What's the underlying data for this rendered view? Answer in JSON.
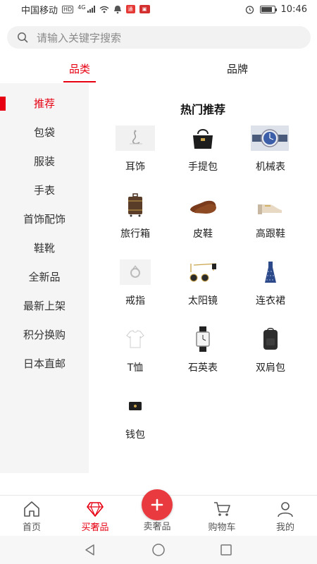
{
  "status_bar": {
    "carrier": "中国移动",
    "hd_badge": "HD",
    "network": "4G",
    "time": "10:46",
    "battery_level": 0.85
  },
  "search": {
    "placeholder": "请输入关键字搜索",
    "icon": "search-icon"
  },
  "tabs": [
    {
      "label": "品类",
      "active": true
    },
    {
      "label": "品牌",
      "active": false
    }
  ],
  "sidebar": {
    "items": [
      {
        "label": "推荐",
        "active": true
      },
      {
        "label": "包袋"
      },
      {
        "label": "服装"
      },
      {
        "label": "手表"
      },
      {
        "label": "首饰配饰"
      },
      {
        "label": "鞋靴"
      },
      {
        "label": "全新品"
      },
      {
        "label": "最新上架"
      },
      {
        "label": "积分换购"
      },
      {
        "label": "日本直邮"
      }
    ]
  },
  "main": {
    "section_title": "热门推荐",
    "items": [
      {
        "label": "耳饰",
        "icon": "earring-icon"
      },
      {
        "label": "手提包",
        "icon": "handbag-icon"
      },
      {
        "label": "机械表",
        "icon": "watch-icon"
      },
      {
        "label": "旅行箱",
        "icon": "suitcase-icon"
      },
      {
        "label": "皮鞋",
        "icon": "loafer-icon"
      },
      {
        "label": "高跟鞋",
        "icon": "heels-icon"
      },
      {
        "label": "戒指",
        "icon": "ring-icon"
      },
      {
        "label": "太阳镜",
        "icon": "sunglasses-icon"
      },
      {
        "label": "连衣裙",
        "icon": "dress-icon"
      },
      {
        "label": "T恤",
        "icon": "tshirt-icon"
      },
      {
        "label": "石英表",
        "icon": "quartz-watch-icon"
      },
      {
        "label": "双肩包",
        "icon": "backpack-icon"
      },
      {
        "label": "钱包",
        "icon": "wallet-icon"
      }
    ]
  },
  "bottom_nav": {
    "items": [
      {
        "label": "首页",
        "icon": "home-icon"
      },
      {
        "label": "买奢品",
        "icon": "diamond-icon",
        "active": true
      },
      {
        "label": "卖奢品",
        "icon": "plus-icon"
      },
      {
        "label": "购物车",
        "icon": "cart-icon"
      },
      {
        "label": "我的",
        "icon": "user-icon"
      }
    ]
  },
  "colors": {
    "accent": "#e60012",
    "sidebar_bg": "#f5f5f5",
    "fab": "#e93a3f"
  }
}
